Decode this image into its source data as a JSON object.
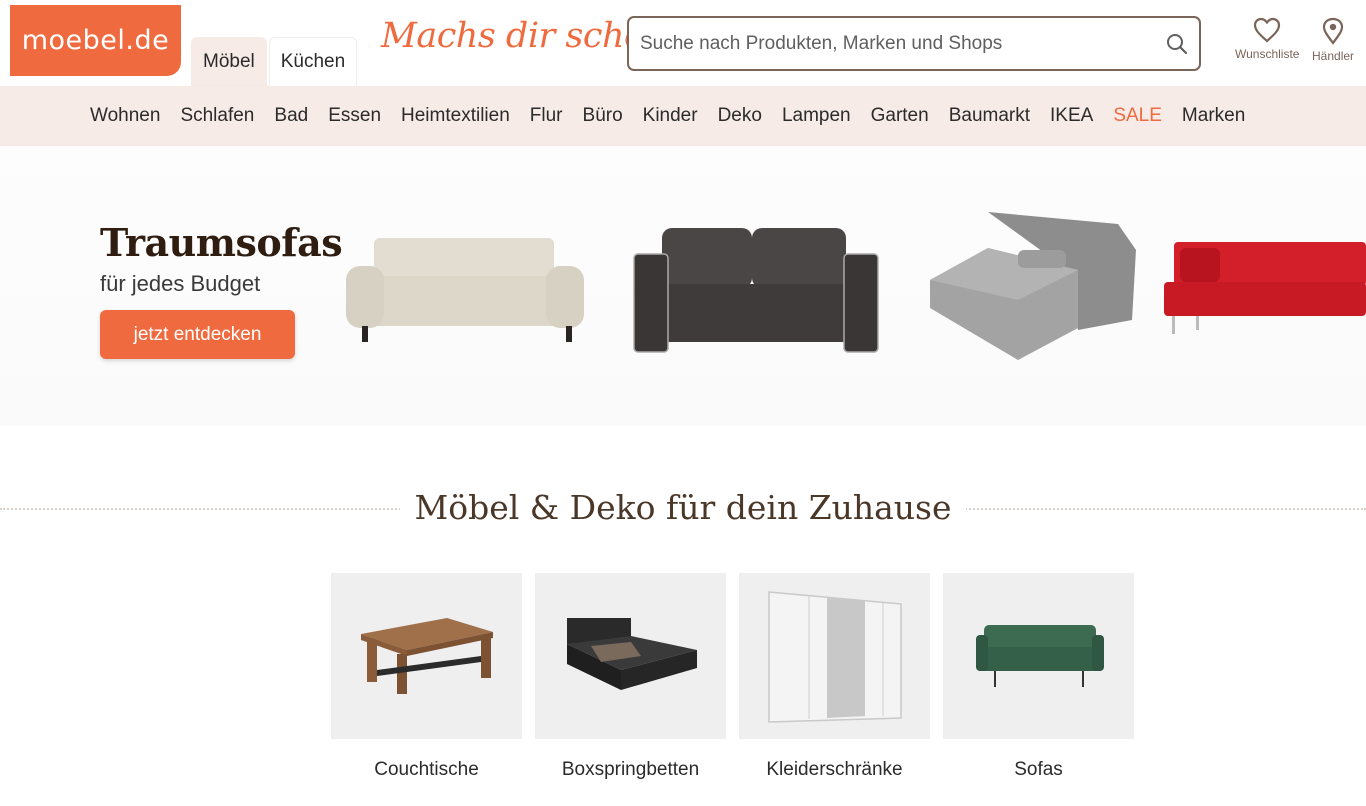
{
  "header": {
    "logo": "moebel.de",
    "tabs": [
      {
        "label": "Möbel",
        "active": true
      },
      {
        "label": "Küchen",
        "active": false
      }
    ],
    "slogan": "Machs dir schoen.",
    "search": {
      "placeholder": "Suche nach Produkten, Marken und Shops",
      "icon": "search-icon"
    },
    "wishlist": {
      "label": "Wunschliste",
      "icon": "heart-icon"
    },
    "dealer": {
      "label": "Händler",
      "icon": "location-pin-icon"
    }
  },
  "nav": {
    "items": [
      "Wohnen",
      "Schlafen",
      "Bad",
      "Essen",
      "Heimtextilien",
      "Flur",
      "Büro",
      "Kinder",
      "Deko",
      "Lampen",
      "Garten",
      "Baumarkt",
      "IKEA",
      "SALE",
      "Marken"
    ],
    "highlight_item": "SALE"
  },
  "hero": {
    "title": "Traumsofas",
    "subtitle": "für jedes Budget",
    "cta": "jetzt entdecken"
  },
  "section": {
    "title": "Möbel & Deko für dein Zuhause",
    "categories": [
      {
        "label": "Couchtische"
      },
      {
        "label": "Boxspringbetten"
      },
      {
        "label": "Kleiderschränke"
      },
      {
        "label": "Sofas"
      }
    ]
  },
  "colors": {
    "brand": "#ef6a3e",
    "nav_bg": "#f6ebe7",
    "text_brown": "#4a3728",
    "icon_brown": "#7a6558"
  }
}
